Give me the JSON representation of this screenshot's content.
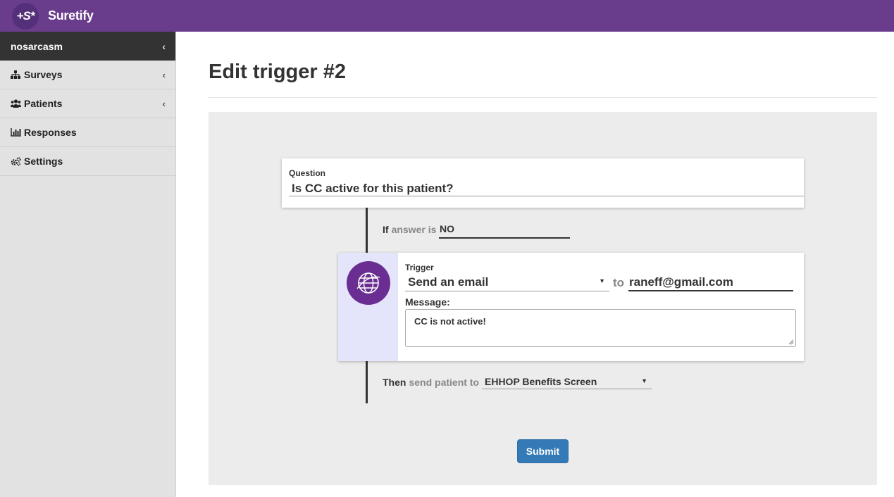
{
  "app": {
    "logo_text": "+S*",
    "brand": "Suretify",
    "brand_color": "#6a3d8c"
  },
  "sidebar": {
    "user": "nosarcasm",
    "items": [
      {
        "label": "Surveys",
        "icon": "sitemap-icon",
        "has_chevron": true
      },
      {
        "label": "Patients",
        "icon": "users-icon",
        "has_chevron": true
      },
      {
        "label": "Responses",
        "icon": "bar-chart-icon",
        "has_chevron": false
      },
      {
        "label": "Settings",
        "icon": "gears-icon",
        "has_chevron": false
      }
    ]
  },
  "page": {
    "title": "Edit trigger #2"
  },
  "question": {
    "label": "Question",
    "text": "Is CC active for this patient?"
  },
  "condition": {
    "if_label": "If",
    "answer_label": "answer is",
    "answer_value": "NO"
  },
  "trigger": {
    "label": "Trigger",
    "action": "Send an email",
    "to_label": "to",
    "recipient": "raneff@gmail.com",
    "message_label": "Message:",
    "message": "CC is not active!",
    "icon": "globe-icon",
    "accent_color": "#6a2d91"
  },
  "then": {
    "then_label": "Then",
    "send_label": "send patient to",
    "destination": "EHHOP Benefits Screen"
  },
  "submit_label": "Submit"
}
